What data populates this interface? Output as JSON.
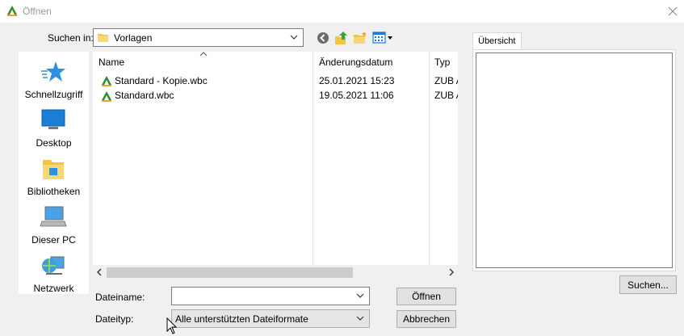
{
  "window": {
    "title": "Öffnen"
  },
  "look_in": {
    "label": "Suchen in:",
    "value": "Vorlagen"
  },
  "places": [
    {
      "label": "Schnellzugriff",
      "icon": "star-icon"
    },
    {
      "label": "Desktop",
      "icon": "desktop-icon"
    },
    {
      "label": "Bibliotheken",
      "icon": "libraries-icon"
    },
    {
      "label": "Dieser PC",
      "icon": "this-pc-icon"
    },
    {
      "label": "Netzwerk",
      "icon": "network-icon"
    }
  ],
  "file_list": {
    "columns": [
      "Name",
      "Änderungsdatum",
      "Typ"
    ],
    "rows": [
      {
        "name": "Standard - Kopie.wbc",
        "date": "25.01.2021 15:23",
        "type": "ZUB A"
      },
      {
        "name": "Standard.wbc",
        "date": "19.05.2021 11:06",
        "type": "ZUB A"
      }
    ]
  },
  "preview": {
    "tab_label": "Übersicht",
    "search_button": "Suchen..."
  },
  "filename": {
    "label": "Dateiname:",
    "value": ""
  },
  "filetype": {
    "label": "Dateityp:",
    "value": "Alle unterstützten Dateiformate"
  },
  "buttons": {
    "open": "Öffnen",
    "cancel": "Abbrechen"
  },
  "colors": {
    "accent_green": "#2e8b2e",
    "accent_orange": "#f0a030",
    "folder_yellow": "#f5c542",
    "selection_blue": "#1e78d7"
  }
}
